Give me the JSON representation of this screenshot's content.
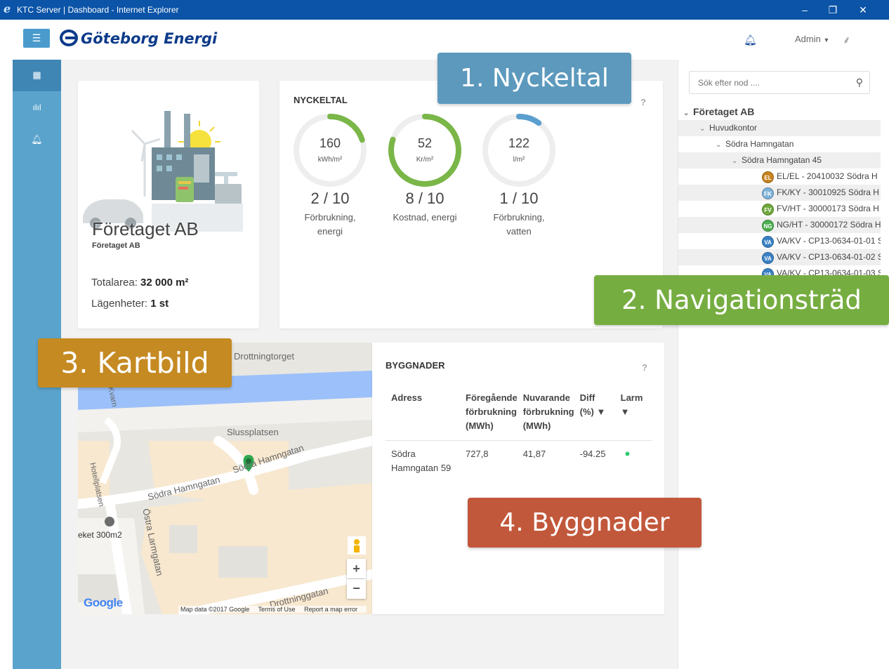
{
  "window": {
    "title": "KTC Server | Dashboard - Internet Explorer"
  },
  "header": {
    "brand": "Göteborg Energi",
    "user_menu": "Admin"
  },
  "company_card": {
    "name": "Företaget AB",
    "subname": "Företaget AB",
    "area_label": "Totalarea:",
    "area_value": "32 000 m²",
    "apartments_label": "Lägenheter:",
    "apartments_value": "1 st"
  },
  "kpi": {
    "title": "NYCKELTAL",
    "help": "?",
    "gauges": [
      {
        "value": "160",
        "unit": "kWh/m²",
        "rank": "2 / 10",
        "label_line1": "Förbrukning,",
        "label_line2": "energi",
        "fill_fraction": 0.2,
        "color": "#7ab648"
      },
      {
        "value": "52",
        "unit": "Kr/m²",
        "rank": "8 / 10",
        "label_line1": "Kostnad, energi",
        "label_line2": "",
        "fill_fraction": 0.8,
        "color": "#7ab648"
      },
      {
        "value": "122",
        "unit": "l/m²",
        "rank": "1 / 10",
        "label_line1": "Förbrukning,",
        "label_line2": "vatten",
        "fill_fraction": 0.1,
        "color": "#5a9fcf"
      }
    ]
  },
  "callouts": {
    "nyckeltal": "1. Nyckeltal",
    "navigation": "2. Navigationsträd",
    "map": "3. Kartbild",
    "buildings": "4. Byggnader"
  },
  "map": {
    "labels": {
      "drottningtorget": "Drottningtorget",
      "slussplatsen": "Slussplatsen",
      "sodra_hamngatan_1": "Södra Hamngatan",
      "sodra_hamngatan_2": "Södra Hamngatan",
      "hotellplatsen": "Hotellplatsen",
      "ostra_larmgatan": "Östra Larmgatan",
      "kvarn": "Kvarn",
      "drottninggatan": "Drottninggatan",
      "eket": "eket 300m2"
    },
    "google": "Google",
    "attribution": "Map data ©2017 Google",
    "terms": "Terms of Use",
    "report": "Report a map error",
    "zoom_in": "+",
    "zoom_out": "−"
  },
  "buildings": {
    "title": "BYGGNADER",
    "help": "?",
    "columns": [
      {
        "l1": "Adress",
        "l2": "",
        "l3": ""
      },
      {
        "l1": "Föregående",
        "l2": "förbrukning",
        "l3": "(MWh)"
      },
      {
        "l1": "Nuvarande",
        "l2": "förbrukning",
        "l3": "(MWh)"
      },
      {
        "l1": "Diff",
        "l2": "(%) ▼",
        "l3": ""
      },
      {
        "l1": "Larm",
        "l2": "▼",
        "l3": ""
      }
    ],
    "rows": [
      {
        "address_l1": "Södra",
        "address_l2": "Hamngatan 59",
        "previous": "727,8",
        "current": "41,87",
        "diff": "-94.25",
        "alarm": "•",
        "alarm_color": "#2ecc71"
      }
    ]
  },
  "search": {
    "placeholder": "Sök efter nod ...."
  },
  "tree": {
    "root": "Företaget AB",
    "level1": "Huvudkontor",
    "level2": "Södra Hamngatan",
    "level3": "Södra Hamngatan 45",
    "nodes": [
      {
        "badge": "EL",
        "badge_color": "#c8841f",
        "label": "EL/EL - 20410032 Södra H"
      },
      {
        "badge": "FK",
        "badge_color": "#7fb2d8",
        "label": "FK/KY - 30010925 Södra H"
      },
      {
        "badge": "FV",
        "badge_color": "#6fa83c",
        "label": "FV/HT - 30000173 Södra H"
      },
      {
        "badge": "NG",
        "badge_color": "#4caf50",
        "label": "NG/HT - 30000172 Södra H"
      },
      {
        "badge": "VA",
        "badge_color": "#3a82c4",
        "label": "VA/KV - CP13-0634-01-01 S"
      },
      {
        "badge": "VA",
        "badge_color": "#3a82c4",
        "label": "VA/KV - CP13-0634-01-02 S"
      },
      {
        "badge": "VA",
        "badge_color": "#3a82c4",
        "label": "VA/KV - CP13-0634-01-03 S"
      }
    ]
  }
}
